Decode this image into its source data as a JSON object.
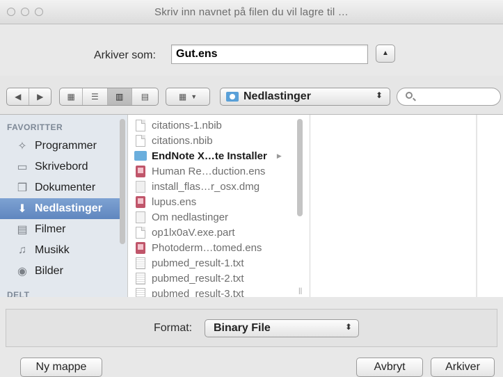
{
  "window": {
    "title": "Skriv inn navnet på filen du vil lagre til …"
  },
  "save": {
    "label": "Arkiver som:",
    "filename": "Gut.ens"
  },
  "toolbar": {
    "location": "Nedlastinger"
  },
  "sidebar": {
    "favorites_header": "FAVORITTER",
    "shared_header": "DELT",
    "items": [
      {
        "label": "Programmer",
        "icon": "applications-icon"
      },
      {
        "label": "Skrivebord",
        "icon": "desktop-icon"
      },
      {
        "label": "Dokumenter",
        "icon": "documents-icon"
      },
      {
        "label": "Nedlastinger",
        "icon": "downloads-icon",
        "selected": true
      },
      {
        "label": "Filmer",
        "icon": "movies-icon"
      },
      {
        "label": "Musikk",
        "icon": "music-icon"
      },
      {
        "label": "Bilder",
        "icon": "pictures-icon"
      }
    ]
  },
  "files": [
    {
      "name": "citations-1.nbib",
      "type": "doc"
    },
    {
      "name": "citations.nbib",
      "type": "doc"
    },
    {
      "name": "EndNote X…te Installer",
      "type": "folder"
    },
    {
      "name": "Human Re…duction.ens",
      "type": "ens"
    },
    {
      "name": "install_flas…r_osx.dmg",
      "type": "dmg"
    },
    {
      "name": "lupus.ens",
      "type": "ens"
    },
    {
      "name": "Om nedlastinger",
      "type": "info"
    },
    {
      "name": "op1lx0aV.exe.part",
      "type": "doc"
    },
    {
      "name": "Photoderm…tomed.ens",
      "type": "ens"
    },
    {
      "name": "pubmed_result-1.txt",
      "type": "txt"
    },
    {
      "name": "pubmed_result-2.txt",
      "type": "txt"
    },
    {
      "name": "pubmed_result-3.txt",
      "type": "txt"
    }
  ],
  "format": {
    "label": "Format:",
    "value": "Binary File"
  },
  "buttons": {
    "new_folder": "Ny mappe",
    "cancel": "Avbryt",
    "save": "Arkiver"
  }
}
